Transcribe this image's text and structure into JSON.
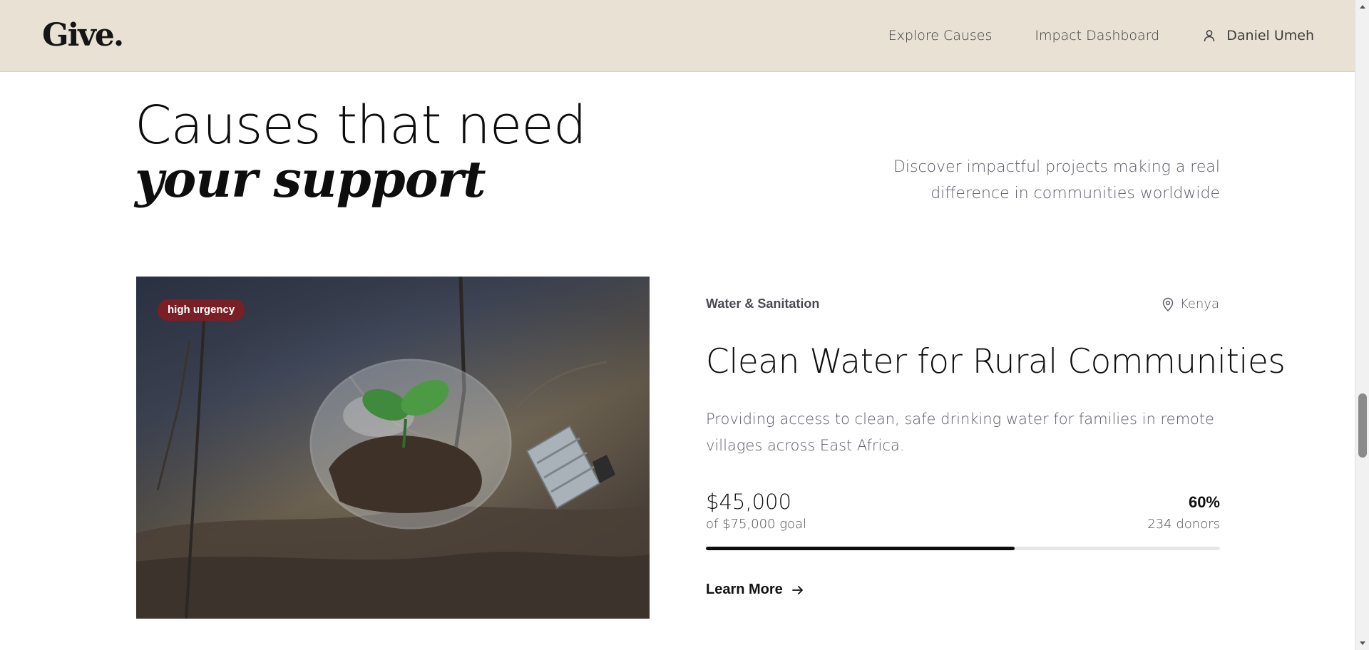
{
  "header": {
    "logo": "Give.",
    "nav": {
      "explore_label": "Explore Causes",
      "dashboard_label": "Impact Dashboard",
      "user_name": "Daniel Umeh"
    }
  },
  "hero": {
    "title_line1": "Causes that need",
    "title_line2": "your support",
    "description": "Discover impactful projects making a real difference in communities worldwide"
  },
  "cause": {
    "urgency": "high urgency",
    "category": "Water & Sanitation",
    "location": "Kenya",
    "title": "Clean Water for Rural Communities",
    "description": "Providing access to clean, safe drinking water for families in remote villages across East Africa.",
    "raised": "$45,000",
    "goal": "of $75,000 goal",
    "percent": "60%",
    "progress": 0.6,
    "donors": "234 donors",
    "cta_label": "Learn More"
  },
  "icons": {
    "user": "user-icon",
    "location": "map-pin-icon",
    "cta": "arrow-right-icon"
  },
  "colors": {
    "header_bg": "#e8e1d4",
    "badge_bg": "#7a1f25",
    "progress_fill": "#0d0d0d",
    "progress_track": "#e6e6e6"
  }
}
